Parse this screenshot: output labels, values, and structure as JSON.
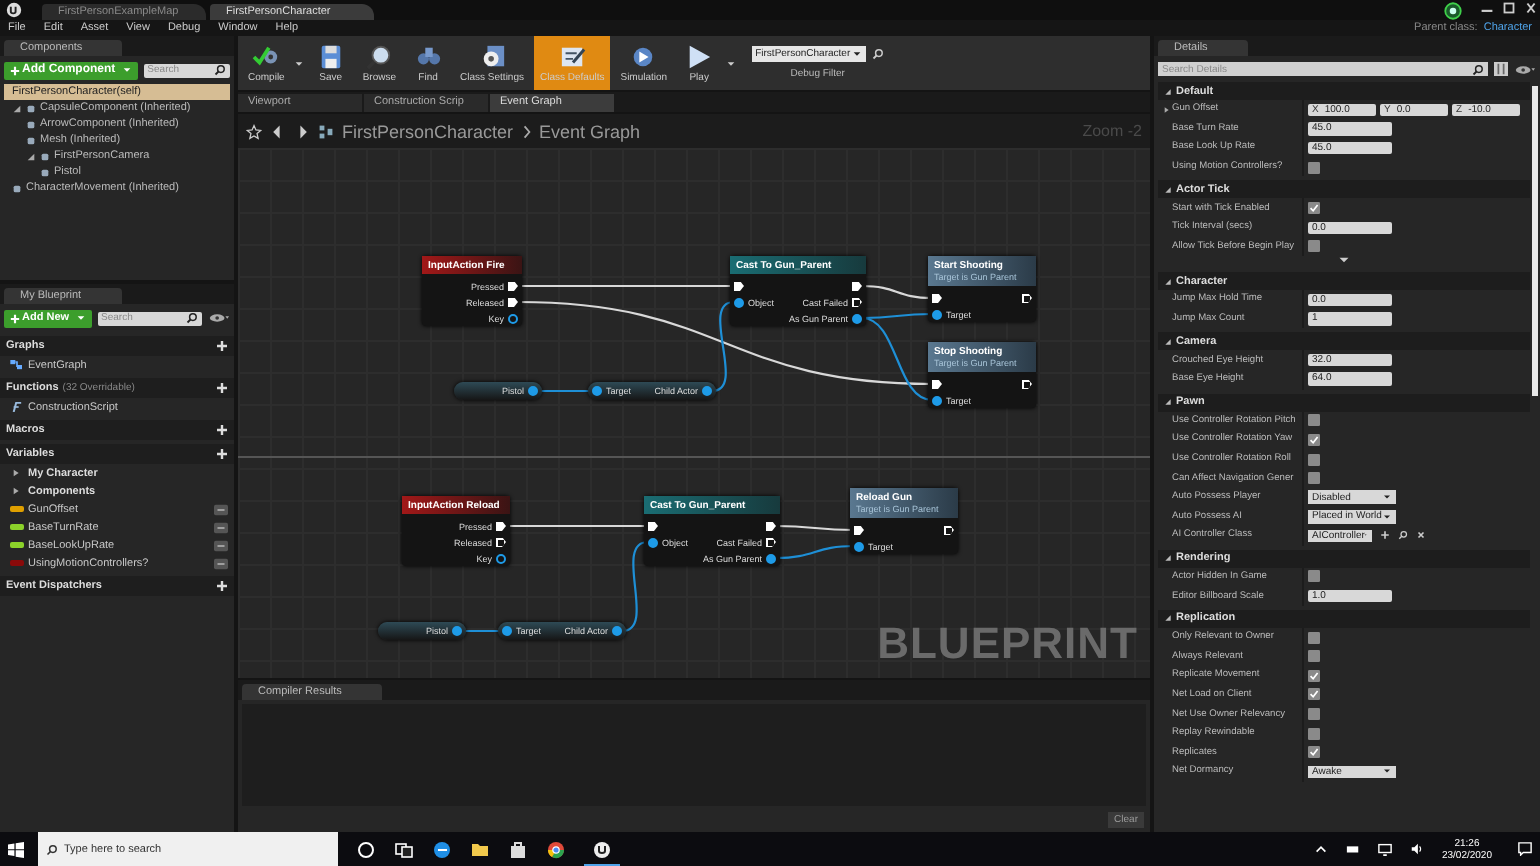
{
  "title_tabs": [
    {
      "label": "FirstPersonExampleMap",
      "selected": false
    },
    {
      "label": "FirstPersonCharacter",
      "selected": true
    }
  ],
  "menu": [
    "File",
    "Edit",
    "Asset",
    "View",
    "Debug",
    "Window",
    "Help"
  ],
  "parent_class": {
    "label": "Parent class:",
    "value": "Character"
  },
  "components": {
    "title": "Components",
    "add_button": "Add Component",
    "search_placeholder": "Search",
    "self_item": {
      "label": "FirstPersonCharacter(self)",
      "selected": true
    },
    "tree": [
      {
        "label": "CapsuleComponent (Inherited)",
        "selected": false,
        "expanded": true,
        "children": [
          {
            "label": "ArrowComponent (Inherited)",
            "selected": false
          },
          {
            "label": "Mesh (Inherited)",
            "selected": false
          },
          {
            "label": "FirstPersonCamera",
            "selected": false,
            "expanded": true,
            "children": [
              {
                "label": "Pistol",
                "selected": false
              }
            ]
          }
        ]
      },
      {
        "label": "CharacterMovement (Inherited)",
        "selected": false
      }
    ]
  },
  "my_blueprint": {
    "title": "My Blueprint",
    "add_button": "Add New",
    "search_placeholder": "Search",
    "sections": [
      {
        "title": "Graphs",
        "items": [
          {
            "kind": "graph",
            "label": "EventGraph"
          }
        ]
      },
      {
        "title": "Functions",
        "note": "(32 Overridable)",
        "items": [
          {
            "kind": "function",
            "label": "ConstructionScript"
          }
        ]
      },
      {
        "title": "Macros"
      },
      {
        "title": "Variables",
        "items": [
          {
            "kind": "category",
            "label": "My Character"
          },
          {
            "kind": "category",
            "label": "Components"
          },
          {
            "kind": "variable",
            "label": "GunOffset",
            "color": "#e0a000"
          },
          {
            "kind": "variable",
            "label": "BaseTurnRate",
            "color": "#8cd22a"
          },
          {
            "kind": "variable",
            "label": "BaseLookUpRate",
            "color": "#8cd22a"
          },
          {
            "kind": "variable",
            "label": "UsingMotionControllers?",
            "color": "#8a0a0a"
          }
        ]
      },
      {
        "title": "Event Dispatchers"
      }
    ]
  },
  "toolbar": [
    {
      "kind": "compile",
      "label": "Compile",
      "selected": false
    },
    {
      "kind": "save",
      "label": "Save",
      "selected": false
    },
    {
      "kind": "browse",
      "label": "Browse",
      "selected": false
    },
    {
      "kind": "find",
      "label": "Find",
      "selected": false
    },
    {
      "kind": "class_settings",
      "label": "Class Settings",
      "selected": false
    },
    {
      "kind": "class_defaults",
      "label": "Class Defaults",
      "selected": true
    },
    {
      "kind": "simulation",
      "label": "Simulation",
      "selected": false
    },
    {
      "kind": "play",
      "label": "Play",
      "selected": false
    }
  ],
  "debug_filter": {
    "value": "FirstPersonCharacter",
    "label": "Debug Filter"
  },
  "document_tabs": [
    {
      "label": "Viewport",
      "selected": false
    },
    {
      "label": "Construction Scrip",
      "selected": false
    },
    {
      "label": "Event Graph",
      "selected": true
    }
  ],
  "graph": {
    "breadcrumb": [
      "FirstPersonCharacter",
      "Event Graph"
    ],
    "zoom": "Zoom -2",
    "watermark": "BLUEPRINT",
    "nodes": [
      {
        "kind": "event",
        "title": "InputAction Fire",
        "rows": [
          {
            "out": {
              "kind": "exec",
              "label": "Pressed",
              "connected": true
            }
          },
          {
            "out": {
              "kind": "exec",
              "label": "Released",
              "connected": true
            }
          },
          {
            "out": {
              "kind": "data",
              "label": "Key",
              "connected": false
            }
          }
        ]
      },
      {
        "kind": "cast",
        "title": "Cast To Gun_Parent",
        "rows": [
          {
            "in": {
              "kind": "exec",
              "connected": true
            },
            "out": {
              "kind": "exec",
              "connected": true
            }
          },
          {
            "in": {
              "kind": "data",
              "label": "Object",
              "connected": true
            },
            "out": {
              "kind": "exec",
              "label": "Cast Failed",
              "connected": false
            }
          },
          {
            "out": {
              "kind": "data",
              "label": "As Gun Parent",
              "connected": true
            }
          }
        ]
      },
      {
        "kind": "function",
        "title": "Start Shooting",
        "subtitle": "Target is Gun Parent",
        "rows": [
          {
            "in": {
              "kind": "exec",
              "connected": true
            },
            "out": {
              "kind": "exec",
              "connected": false
            }
          },
          {
            "in": {
              "kind": "data",
              "label": "Target",
              "connected": true
            }
          }
        ]
      },
      {
        "kind": "function",
        "title": "Stop Shooting",
        "subtitle": "Target is Gun Parent",
        "rows": [
          {
            "in": {
              "kind": "exec",
              "connected": true
            },
            "out": {
              "kind": "exec",
              "connected": false
            }
          },
          {
            "in": {
              "kind": "data",
              "label": "Target",
              "connected": true
            }
          }
        ]
      },
      {
        "kind": "variable",
        "rows": [
          {
            "out": {
              "kind": "data",
              "label": "Pistol",
              "connected": true
            }
          }
        ]
      },
      {
        "kind": "pure",
        "rows": [
          {
            "in": {
              "kind": "data",
              "label": "Target",
              "connected": true
            },
            "out": {
              "kind": "data",
              "label": "Child Actor",
              "connected": true
            }
          }
        ]
      },
      {
        "kind": "event",
        "title": "InputAction Reload",
        "rows": [
          {
            "out": {
              "kind": "exec",
              "label": "Pressed",
              "connected": true
            }
          },
          {
            "out": {
              "kind": "exec",
              "label": "Released",
              "connected": false
            }
          },
          {
            "out": {
              "kind": "data",
              "label": "Key",
              "connected": false
            }
          }
        ]
      },
      {
        "kind": "cast",
        "title": "Cast To Gun_Parent",
        "rows": [
          {
            "in": {
              "kind": "exec",
              "connected": true
            },
            "out": {
              "kind": "exec",
              "connected": true
            }
          },
          {
            "in": {
              "kind": "data",
              "label": "Object",
              "connected": true
            },
            "out": {
              "kind": "exec",
              "label": "Cast Failed",
              "connected": false
            }
          },
          {
            "out": {
              "kind": "data",
              "label": "As Gun Parent",
              "connected": true
            }
          }
        ]
      },
      {
        "kind": "function",
        "title": "Reload Gun",
        "subtitle": "Target is Gun Parent",
        "rows": [
          {
            "in": {
              "kind": "exec",
              "connected": true
            },
            "out": {
              "kind": "exec",
              "connected": false
            }
          },
          {
            "in": {
              "kind": "data",
              "label": "Target",
              "connected": true
            }
          }
        ]
      },
      {
        "kind": "variable",
        "rows": [
          {
            "out": {
              "kind": "data",
              "label": "Pistol",
              "connected": true
            }
          }
        ]
      },
      {
        "kind": "pure",
        "rows": [
          {
            "in": {
              "kind": "data",
              "label": "Target",
              "connected": true
            },
            "out": {
              "kind": "data",
              "label": "Child Actor",
              "connected": true
            }
          }
        ]
      }
    ]
  },
  "compiler_results": {
    "title": "Compiler Results",
    "clear_button": "Clear"
  },
  "details": {
    "title": "Details",
    "search_placeholder": "Search Details",
    "sections": [
      {
        "title": "Default",
        "rows": [
          {
            "kind": "vector",
            "label": "Gun Offset",
            "values": [
              {
                "axis": "X",
                "value": "100.0"
              },
              {
                "axis": "Y",
                "value": "0.0"
              },
              {
                "axis": "Z",
                "value": "-10.0"
              }
            ]
          },
          {
            "kind": "number",
            "label": "Base Turn Rate",
            "value": "45.0"
          },
          {
            "kind": "number",
            "label": "Base Look Up Rate",
            "value": "45.0"
          },
          {
            "kind": "checkbox",
            "label": "Using Motion Controllers?",
            "checked": false
          }
        ]
      },
      {
        "title": "Actor Tick",
        "has_advanced": true,
        "rows": [
          {
            "kind": "checkbox",
            "label": "Start with Tick Enabled",
            "checked": true
          },
          {
            "kind": "number",
            "label": "Tick Interval (secs)",
            "value": "0.0"
          },
          {
            "kind": "checkbox",
            "label": "Allow Tick Before Begin Play",
            "checked": false
          }
        ]
      },
      {
        "title": "Character",
        "rows": [
          {
            "kind": "number",
            "label": "Jump Max Hold Time",
            "value": "0.0"
          },
          {
            "kind": "number",
            "label": "Jump Max Count",
            "value": "1"
          }
        ]
      },
      {
        "title": "Camera",
        "rows": [
          {
            "kind": "number",
            "label": "Crouched Eye Height",
            "value": "32.0"
          },
          {
            "kind": "number",
            "label": "Base Eye Height",
            "value": "64.0"
          }
        ]
      },
      {
        "title": "Pawn",
        "rows": [
          {
            "kind": "checkbox",
            "label": "Use Controller Rotation Pitch",
            "checked": false
          },
          {
            "kind": "checkbox",
            "label": "Use Controller Rotation Yaw",
            "checked": true
          },
          {
            "kind": "checkbox",
            "label": "Use Controller Rotation Roll",
            "checked": false
          },
          {
            "kind": "checkbox",
            "label": "Can Affect Navigation Gener",
            "checked": false
          },
          {
            "kind": "dropdown",
            "label": "Auto Possess Player",
            "value": "Disabled"
          },
          {
            "kind": "dropdown",
            "label": "Auto Possess AI",
            "value": "Placed in World"
          },
          {
            "kind": "class",
            "label": "AI Controller Class",
            "value": "AIController"
          }
        ]
      },
      {
        "title": "Rendering",
        "rows": [
          {
            "kind": "checkbox",
            "label": "Actor Hidden In Game",
            "checked": false
          },
          {
            "kind": "number",
            "label": "Editor Billboard Scale",
            "value": "1.0"
          }
        ]
      },
      {
        "title": "Replication",
        "rows": [
          {
            "kind": "checkbox",
            "label": "Only Relevant to Owner",
            "checked": false
          },
          {
            "kind": "checkbox",
            "label": "Always Relevant",
            "checked": false
          },
          {
            "kind": "checkbox",
            "label": "Replicate Movement",
            "checked": true
          },
          {
            "kind": "checkbox",
            "label": "Net Load on Client",
            "checked": true
          },
          {
            "kind": "checkbox",
            "label": "Net Use Owner Relevancy",
            "checked": false
          },
          {
            "kind": "checkbox",
            "label": "Replay Rewindable",
            "checked": false
          },
          {
            "kind": "checkbox",
            "label": "Replicates",
            "checked": true
          },
          {
            "kind": "dropdown",
            "label": "Net Dormancy",
            "value": "Awake"
          }
        ]
      }
    ]
  },
  "taskbar": {
    "search_placeholder": "Type here to search",
    "time": "21:26",
    "date": "23/02/2020"
  }
}
